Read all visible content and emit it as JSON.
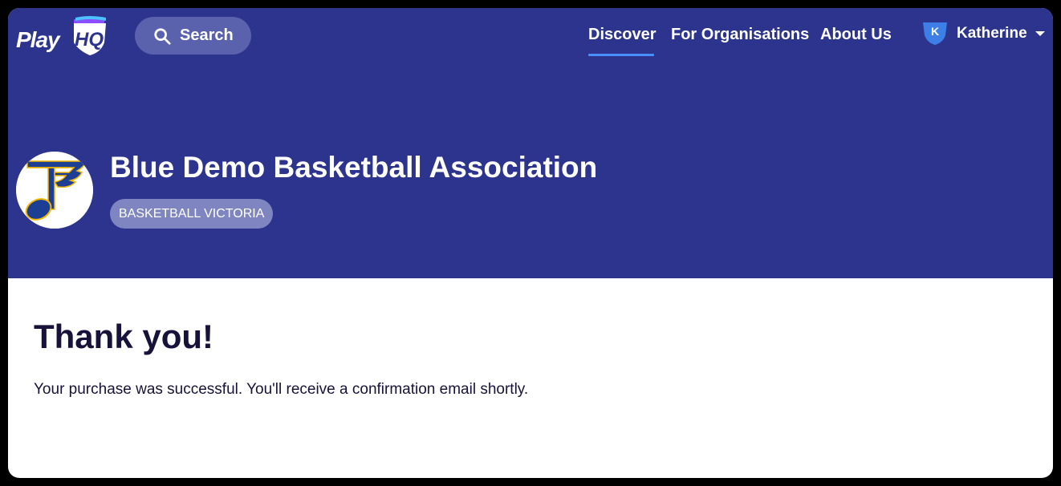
{
  "header": {
    "logo": {
      "play_text": "Play",
      "hq_text": "HQ"
    },
    "search_label": "Search",
    "nav": [
      {
        "label": "Discover",
        "active": true
      },
      {
        "label": "For Organisations",
        "active": false
      },
      {
        "label": "About Us",
        "active": false
      }
    ],
    "user": {
      "initial": "K",
      "name": "Katherine"
    }
  },
  "organisation": {
    "name": "Blue Demo Basketball Association",
    "badge": "BASKETBALL VICTORIA"
  },
  "main": {
    "heading": "Thank you!",
    "message": "Your purchase was successful. You'll receive a confirmation email shortly."
  },
  "colors": {
    "brand": "#2c348d",
    "accent": "#4a8fff",
    "text_dark": "#16123a"
  }
}
